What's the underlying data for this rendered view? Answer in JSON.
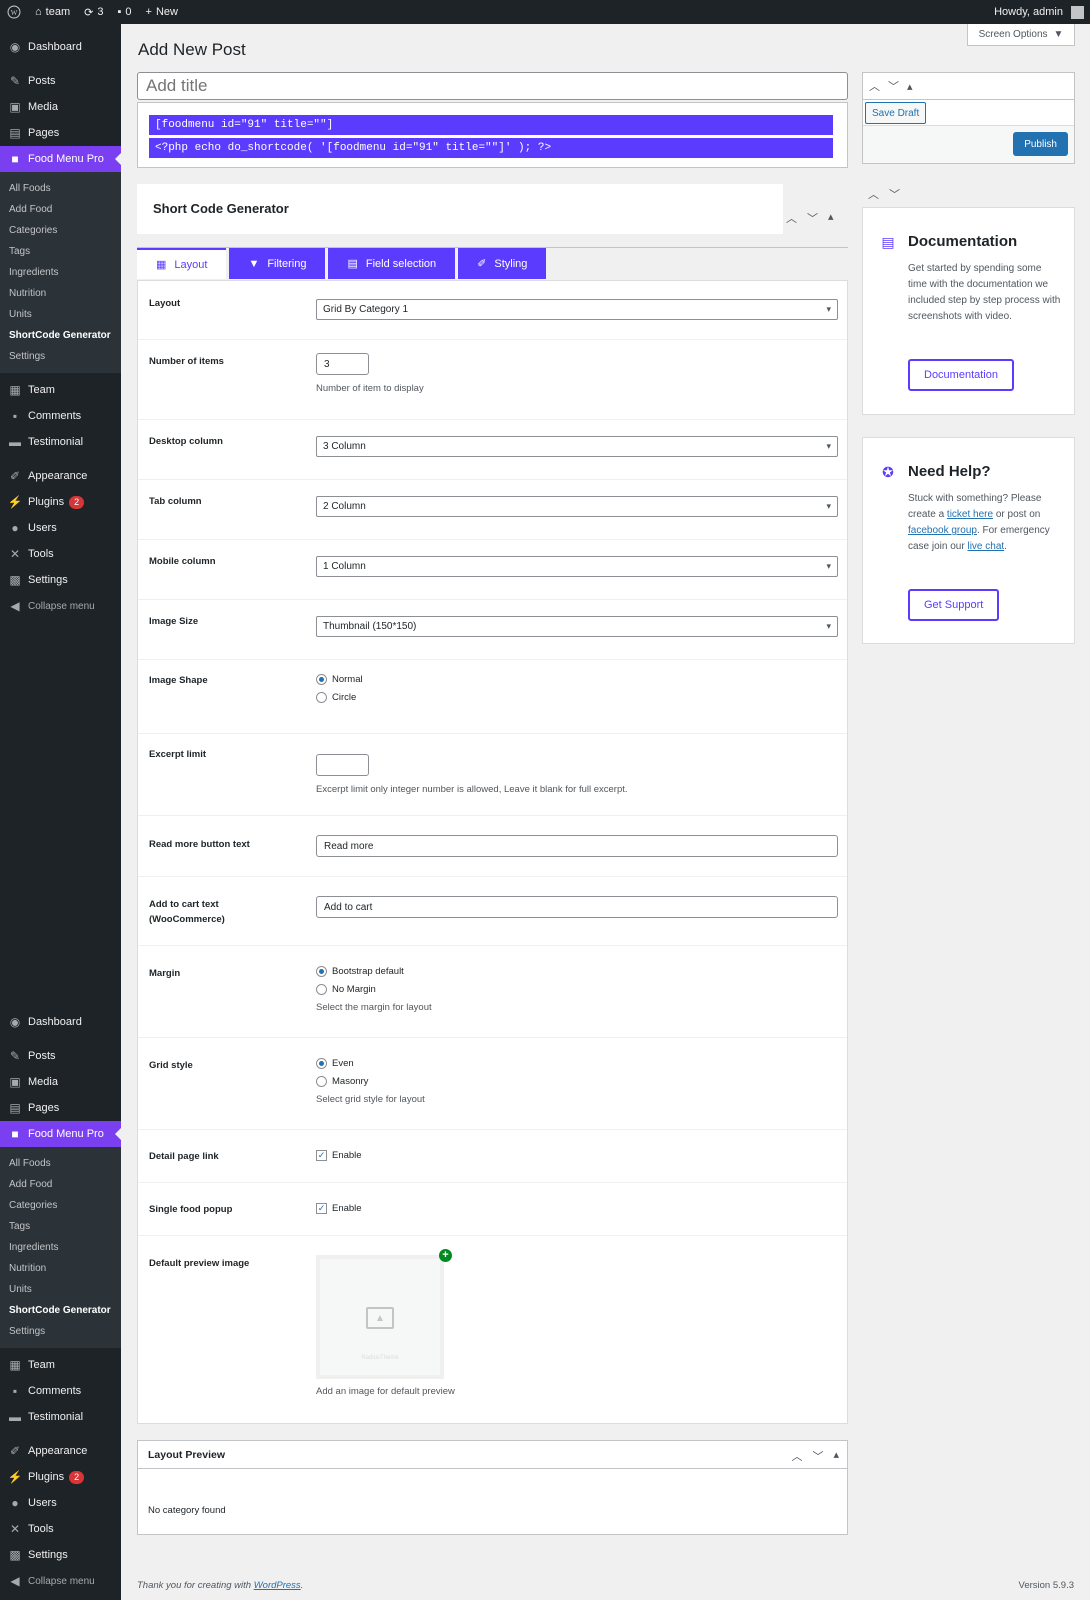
{
  "adminbar": {
    "site": "team",
    "updates": "3",
    "comments": "0",
    "new": "New",
    "howdy": "Howdy, admin"
  },
  "sidebar": {
    "top": [
      "Dashboard"
    ],
    "group1": [
      "Posts",
      "Media",
      "Pages"
    ],
    "active": "Food Menu Pro",
    "submenu": [
      "All Foods",
      "Add Food",
      "Categories",
      "Tags",
      "Ingredients",
      "Nutrition",
      "Units",
      "ShortCode Generator",
      "Settings"
    ],
    "group2": [
      "Team",
      "Comments",
      "Testimonial"
    ],
    "group3": [
      "Appearance",
      "Plugins",
      "Users",
      "Tools",
      "Settings"
    ],
    "plugins_badge": "2",
    "collapse": "Collapse menu"
  },
  "page": {
    "title": "Add New Post",
    "screen_options": "Screen Options",
    "title_placeholder": "Add title"
  },
  "shortcodes": {
    "line1": "[foodmenu id=\"91\" title=\"\"]",
    "line2": "<?php echo do_shortcode( '[foodmenu id=\"91\" title=\"\"]' ); ?>"
  },
  "publish": {
    "save_draft": "Save Draft",
    "publish": "Publish"
  },
  "documentation": {
    "title": "Documentation",
    "text": "Get started by spending some time with the documentation we included step by step process with screenshots with video.",
    "button": "Documentation"
  },
  "help": {
    "title": "Need Help?",
    "text_1": "Stuck with something? Please create a ",
    "link_1": "ticket here",
    "text_2": " or post on ",
    "link_2": "facebook group",
    "text_3": ". For emergency case join our ",
    "link_3": "live chat",
    "text_4": ".",
    "button": "Get Support"
  },
  "generator": {
    "title": "Short Code Generator",
    "tabs": [
      "Layout",
      "Filtering",
      "Field selection",
      "Styling"
    ],
    "layout": {
      "label": "Layout",
      "value": "Grid By Category 1"
    },
    "items": {
      "label": "Number of items",
      "value": "3",
      "help": "Number of item to display"
    },
    "desktop": {
      "label": "Desktop column",
      "value": "3 Column"
    },
    "tab_col": {
      "label": "Tab column",
      "value": "2 Column"
    },
    "mobile": {
      "label": "Mobile column",
      "value": "1 Column"
    },
    "image_size": {
      "label": "Image Size",
      "value": "Thumbnail (150*150)"
    },
    "image_shape": {
      "label": "Image Shape",
      "options": [
        "Normal",
        "Circle"
      ],
      "selected": "Normal"
    },
    "excerpt": {
      "label": "Excerpt limit",
      "value": "",
      "help": "Excerpt limit only integer number is allowed, Leave it blank for full excerpt."
    },
    "read_more": {
      "label": "Read more button text",
      "value": "Read more"
    },
    "add_to_cart": {
      "label_1": "Add to cart text",
      "label_2": "(WooCommerce)",
      "value": "Add to cart"
    },
    "margin": {
      "label": "Margin",
      "options": [
        "Bootstrap default",
        "No Margin"
      ],
      "selected": "Bootstrap default",
      "help": "Select the margin for layout"
    },
    "grid_style": {
      "label": "Grid style",
      "options": [
        "Even",
        "Masonry"
      ],
      "selected": "Even",
      "help": "Select grid style for layout"
    },
    "detail_link": {
      "label": "Detail page link",
      "option": "Enable",
      "checked": true
    },
    "popup": {
      "label": "Single food popup",
      "option": "Enable",
      "checked": true
    },
    "preview_image": {
      "label": "Default preview image",
      "watermark": "RadiusTheme",
      "help": "Add an image for default preview"
    }
  },
  "layout_preview": {
    "title": "Layout Preview",
    "text": "No category found"
  },
  "footer": {
    "thanks_prefix": "Thank you for creating with ",
    "wordpress": "WordPress",
    "thanks_suffix": ".",
    "version": "Version 5.9.3"
  },
  "colors": {
    "accent": "#5b3cff",
    "wp_blue": "#2271b1",
    "sidebar_bg": "#1d2327"
  }
}
